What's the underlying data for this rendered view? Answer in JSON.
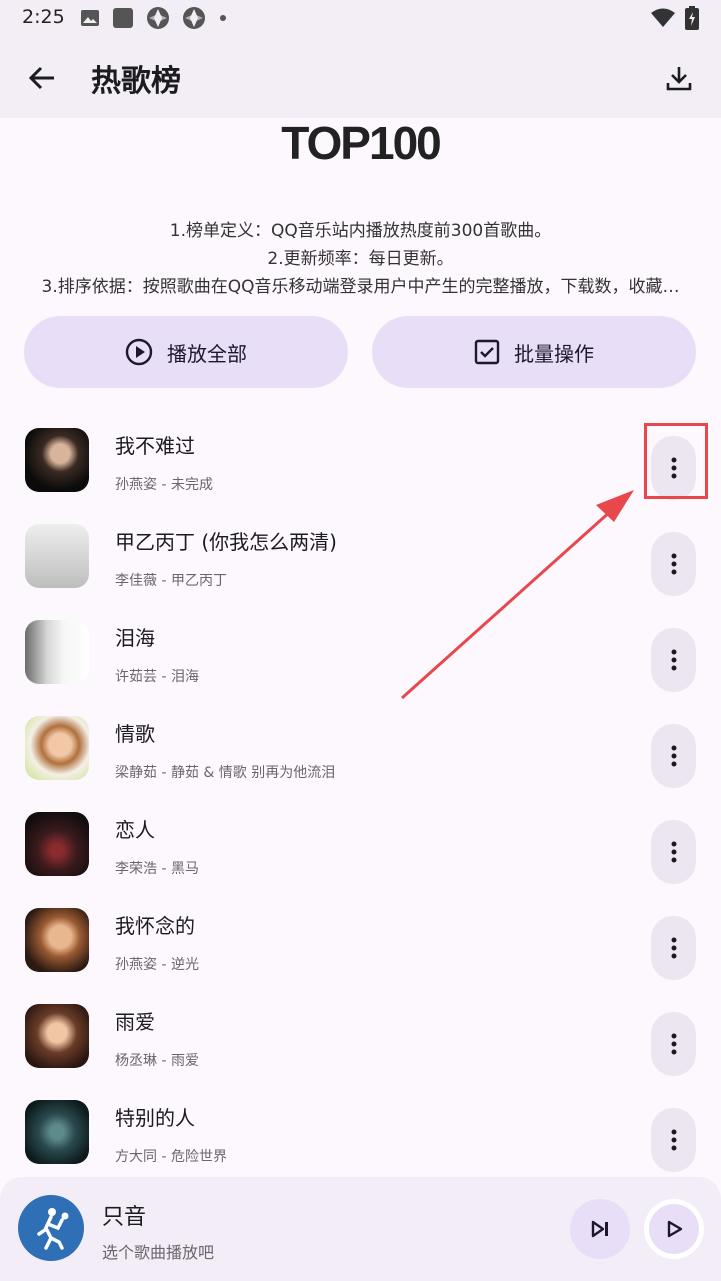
{
  "status_bar": {
    "time": "2:25",
    "icons": [
      "image-icon",
      "square-icon",
      "aperture-icon",
      "aperture-icon",
      "dot-icon",
      "wifi-icon",
      "battery-icon"
    ]
  },
  "app_bar": {
    "title": "热歌榜",
    "back_icon": "arrow-back-icon",
    "download_icon": "download-icon"
  },
  "hero": {
    "title": "TOP100"
  },
  "description": {
    "line1": "1.榜单定义：QQ音乐站内播放热度前300首歌曲。",
    "line2": "2.更新频率：每日更新。",
    "line3": "3.排序依据：按照歌曲在QQ音乐移动端登录用户中产生的完整播放，下载数，收藏…"
  },
  "actions": {
    "play_all": "播放全部",
    "batch": "批量操作"
  },
  "songs": [
    {
      "title": "我不难过",
      "subtitle": "孙燕姿 - 未完成"
    },
    {
      "title": "甲乙丙丁 (你我怎么两清)",
      "subtitle": "李佳薇 - 甲乙丙丁"
    },
    {
      "title": "泪海",
      "subtitle": "许茹芸 - 泪海"
    },
    {
      "title": "情歌",
      "subtitle": "梁静茹 - 静茹 & 情歌 别再为他流泪"
    },
    {
      "title": "恋人",
      "subtitle": "李荣浩 - 黑马"
    },
    {
      "title": "我怀念的",
      "subtitle": "孙燕姿 - 逆光"
    },
    {
      "title": "雨爱",
      "subtitle": "杨丞琳 - 雨爱"
    },
    {
      "title": "特别的人",
      "subtitle": "方大同 - 危险世界"
    }
  ],
  "player": {
    "title": "只音",
    "subtitle": "选个歌曲播放吧"
  },
  "colors": {
    "accent_container": "#e8def8",
    "annotation_red": "#e8474b",
    "background": "#fdf7fe"
  }
}
